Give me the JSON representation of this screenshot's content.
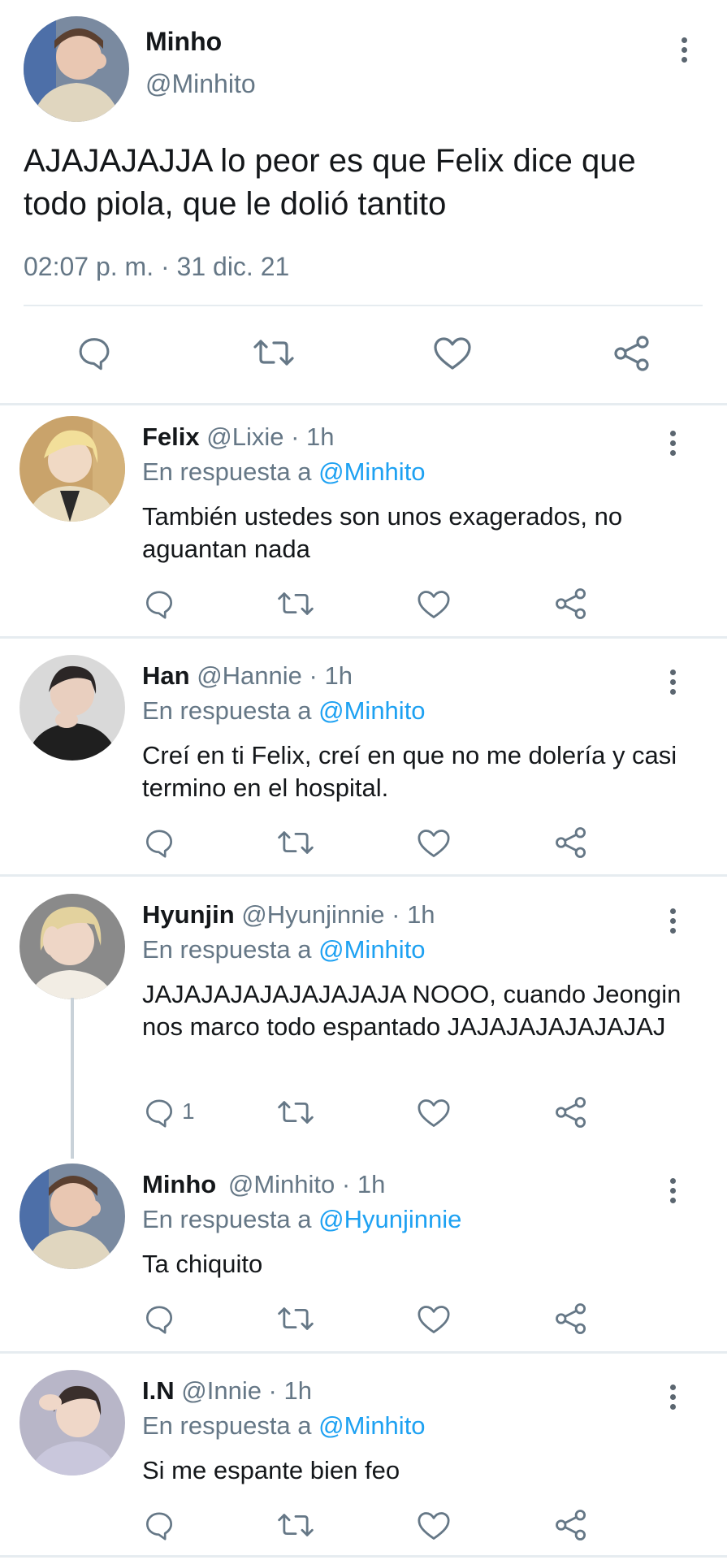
{
  "main_tweet": {
    "name": "Minho",
    "handle": "@Minhito",
    "text": "AJAJAJAJJA lo peor es que Felix dice que todo piola, que le dolió tantito",
    "meta": "02:07 p. m. · 31 dic. 21",
    "actions": [
      "reply-icon",
      "retweet-icon",
      "like-icon",
      "share-icon"
    ]
  },
  "replies": [
    {
      "name": "Felix",
      "handle": "@Lixie · 1h",
      "in_reply_prefix": "En respuesta a ",
      "in_reply_to": "@Minhito",
      "text": "También ustedes son unos exagerados, no aguantan nada",
      "reply_count": ""
    },
    {
      "name": "Han",
      "handle": "@Hannie · 1h",
      "in_reply_prefix": "En respuesta a ",
      "in_reply_to": "@Minhito",
      "text": "Creí en ti Felix, creí en que no me dolería y casi termino en el hospital.",
      "reply_count": ""
    },
    {
      "name": "Hyunjin",
      "handle": "@Hyunjinnie · 1h",
      "in_reply_prefix": "En respuesta a ",
      "in_reply_to": "@Minhito",
      "text": "JAJAJAJAJAJAJAJAJA NOOO, cuando Jeongin nos marco todo espantado JAJAJAJAJAJAJAJ",
      "reply_count": "1"
    },
    {
      "name": "Minho",
      "handle": "@Minhito · 1h",
      "in_reply_prefix": "En respuesta a ",
      "in_reply_to": "@Hyunjinnie",
      "text": "Ta chiquito",
      "reply_count": ""
    },
    {
      "name": "I.N",
      "handle": "@Innie · 1h",
      "in_reply_prefix": "En respuesta a ",
      "in_reply_to": "@Minhito",
      "text": "Si me espante bien feo",
      "reply_count": ""
    }
  ],
  "colors": {
    "text": "#14171a",
    "secondary": "#657786",
    "link": "#1da1f2",
    "divider": "#e6ecf0",
    "icon": "#657786"
  }
}
